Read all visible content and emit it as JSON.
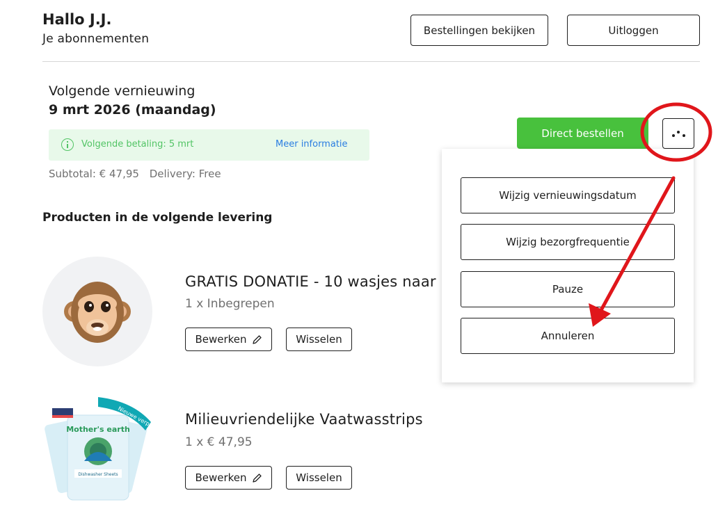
{
  "header": {
    "greeting": "Hallo J.J.",
    "subtitle": "Je abonnementen",
    "orders_button": "Bestellingen bekijken",
    "logout_button": "Uitloggen"
  },
  "renewal": {
    "label": "Volgende vernieuwing",
    "date": "9 mrt 2026 (maandag)",
    "info_text": "Volgende betaling: 5 mrt",
    "info_link": "Meer informatie",
    "subtotal": "Subtotal: € 47,95",
    "delivery": "Delivery: Free"
  },
  "actions": {
    "direct_order": "Direct bestellen",
    "more_icon": "more-dots-icon"
  },
  "dropdown": {
    "items": [
      "Wijzig vernieuwingsdatum",
      "Wijzig bezorgfrequentie",
      "Pauze",
      "Annuleren"
    ]
  },
  "section_title": "Producten in de volgende levering",
  "products": [
    {
      "title": "GRATIS DONATIE - 10 wasjes naar",
      "qty": "1 x Inbegrepen",
      "edit_label": "Bewerken",
      "swap_label": "Wisselen",
      "image_icon": "monkey-face-icon"
    },
    {
      "title": "Milieuvriendelijke Vaatwasstrips",
      "qty": "1 x € 47,95",
      "edit_label": "Bewerken",
      "swap_label": "Wisselen",
      "image_icon": "dishwasher-sheets-package-icon",
      "package_brand": "Mother's earth",
      "package_product": "Dishwasher Sheets",
      "package_ribbon": "Nieuwe verpakking"
    }
  ],
  "colors": {
    "primary_green": "#48c13d",
    "info_green": "#52c465",
    "info_bg": "#e8f9ea",
    "link_blue": "#2a7de1",
    "annotation_red": "#e0161b"
  }
}
